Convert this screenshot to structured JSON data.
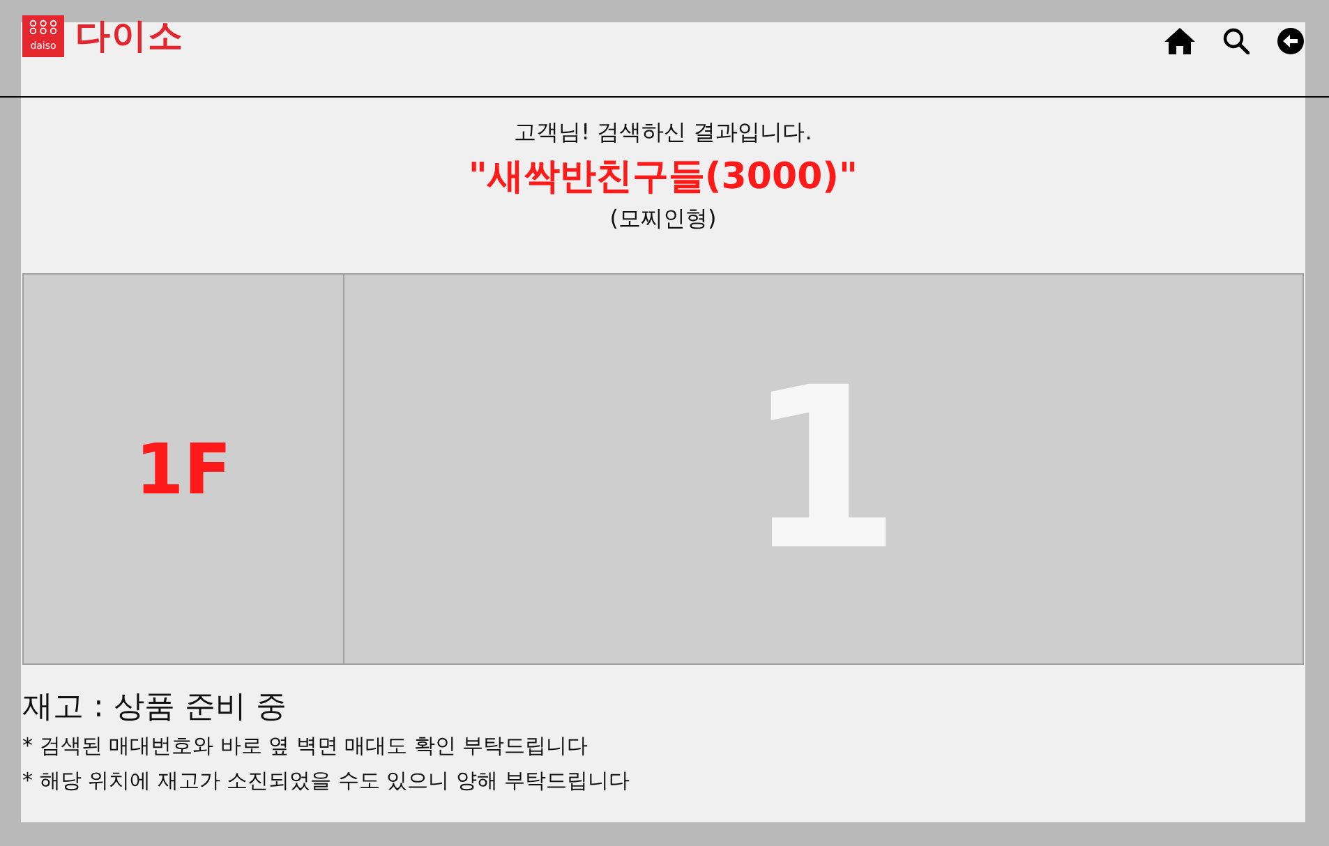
{
  "header": {
    "logo_mark": "daiso",
    "logo_text": "다이소"
  },
  "result": {
    "greeting": "고객님! 검색하신 결과입니다.",
    "product_name": "\"새싹반친구들(3000)\"",
    "product_note": "(모찌인형)"
  },
  "location": {
    "floor": "1F",
    "shelf": "1"
  },
  "stock": {
    "status": "재고 : 상품 준비 중",
    "notes": [
      "* 검색된 매대번호와 바로 옆 벽면 매대도 확인 부탁드립니다",
      "* 해당 위치에 재고가 소진되었을 수도 있으니 양해 부탁드립니다"
    ]
  }
}
